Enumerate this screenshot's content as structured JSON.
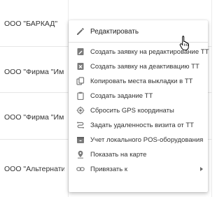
{
  "table": {
    "rows": [
      {
        "name": "ООО \"БАРКАД\""
      },
      {
        "name": "ООО \"Фирма \"Импери"
      },
      {
        "name": "ООО \"Фирма \"Импери"
      },
      {
        "name": "ООО \"Альтернатива\""
      }
    ]
  },
  "context_menu": {
    "items": [
      {
        "label": "Редактировать",
        "icon": "pencil-icon"
      },
      {
        "label": "Создать заявку на редактирование ТТ",
        "icon": "edit-document-icon"
      },
      {
        "label": "Создать заявку на деактивацию ТТ",
        "icon": "deactivate-icon"
      },
      {
        "label": "Копировать места выкладки в ТТ",
        "icon": "copy-icon"
      },
      {
        "label": "Создать задание ТТ",
        "icon": "clipboard-icon"
      },
      {
        "label": "Сбросить GPS координаты",
        "icon": "gps-target-icon"
      },
      {
        "label": "Задать удаленность визита от ТТ",
        "icon": "route-icon"
      },
      {
        "label": "Учет локального POS-оборудования",
        "icon": "pos-box-icon"
      },
      {
        "label": "Показать на карте",
        "icon": "map-pin-icon"
      },
      {
        "label": "Привязать к",
        "icon": "link-icon",
        "has_submenu": true
      }
    ]
  }
}
